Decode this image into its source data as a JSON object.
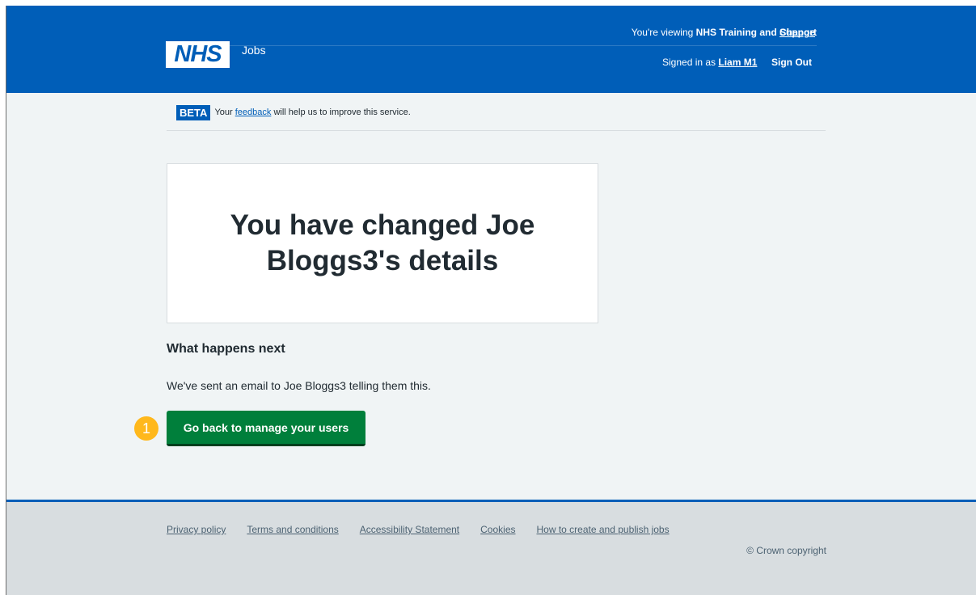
{
  "header": {
    "viewing_prefix": "You're viewing",
    "organisation": "NHS Training and Support",
    "change_label": "Change",
    "logo_text": "NHS",
    "service_name": "Jobs",
    "signed_in_prefix": "Signed in as",
    "user_name": "Liam M1",
    "sign_out_label": "Sign Out"
  },
  "beta": {
    "tag": "BETA",
    "text_before": "Your",
    "feedback_link": "feedback",
    "text_after": "will help us to improve this service."
  },
  "confirmation": {
    "title": "You have changed Joe Bloggs3's details"
  },
  "next": {
    "heading": "What happens next",
    "text": "We've sent an email to Joe Bloggs3 telling them this.",
    "button_label": "Go back to manage your users",
    "step_number": "1"
  },
  "footer": {
    "links": [
      "Privacy policy",
      "Terms and conditions",
      "Accessibility Statement",
      "Cookies",
      "How to create and publish jobs"
    ],
    "copyright": "© Crown copyright"
  },
  "colors": {
    "nhs_blue": "#005eb8",
    "button_green": "#007f3b",
    "badge_yellow": "#ffb81c"
  }
}
